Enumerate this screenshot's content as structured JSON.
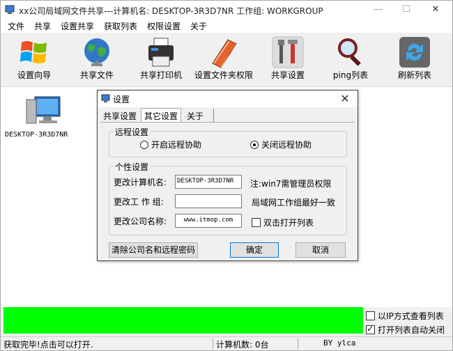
{
  "window": {
    "title": "xx公司局域网文件共享---计算机名: DESKTOP-3R3D7NR  工作组: WORKGROUP",
    "min_glyph": "—",
    "max_glyph": "☐",
    "close_glyph": "✕"
  },
  "menu": [
    "文件",
    "共享",
    "设置共享",
    "获取列表",
    "权限设置",
    "关于"
  ],
  "toolbar": [
    {
      "label": "设置向导",
      "icon": "windows-flag-icon"
    },
    {
      "label": "共享文件",
      "icon": "globe-icon"
    },
    {
      "label": "共享打印机",
      "icon": "printer-icon"
    },
    {
      "label": "设置文件夹权限",
      "icon": "folder-book-icon"
    },
    {
      "label": "共享设置",
      "icon": "tools-icon"
    },
    {
      "label": "ping列表",
      "icon": "magnifier-icon"
    },
    {
      "label": "刷新列表",
      "icon": "refresh-icon"
    }
  ],
  "computers": [
    {
      "name": "DESKTOP-3R3D7NR"
    }
  ],
  "bottom": {
    "view_by_ip": "以IP方式查看列表",
    "auto_close": "打开列表自动关闭",
    "auto_close_checked": true,
    "view_by_ip_checked": false
  },
  "status": {
    "message": "获取完毕!点击可以打开.",
    "count": "计算机数: 0台",
    "author": "BY ylca"
  },
  "dialog": {
    "title": "设置",
    "close_glyph": "✕",
    "tabs": [
      "共享设置",
      "其它设置",
      "关于"
    ],
    "active_tab": 1,
    "remote": {
      "legend": "远程设置",
      "enable_label": "开启远程协助",
      "disable_label": "关闭远程协助",
      "selected": "disable"
    },
    "personal": {
      "legend": "个性设置",
      "computer_name_label": "更改计算机名:",
      "computer_name_value": "DESKTOP-3R3D7NR",
      "computer_name_note": "注:win7需管理员权限",
      "workgroup_label": "更改工 作 组:",
      "workgroup_value": "",
      "workgroup_note": "局域网工作组最好一致",
      "company_label": "更改公司名称:",
      "company_value": "www.itmop.com",
      "dblclick_label": "双击打开列表",
      "dblclick_checked": false
    },
    "buttons": {
      "clear": "清除公司名和远程密码",
      "ok": "确定",
      "cancel": "取消"
    }
  }
}
